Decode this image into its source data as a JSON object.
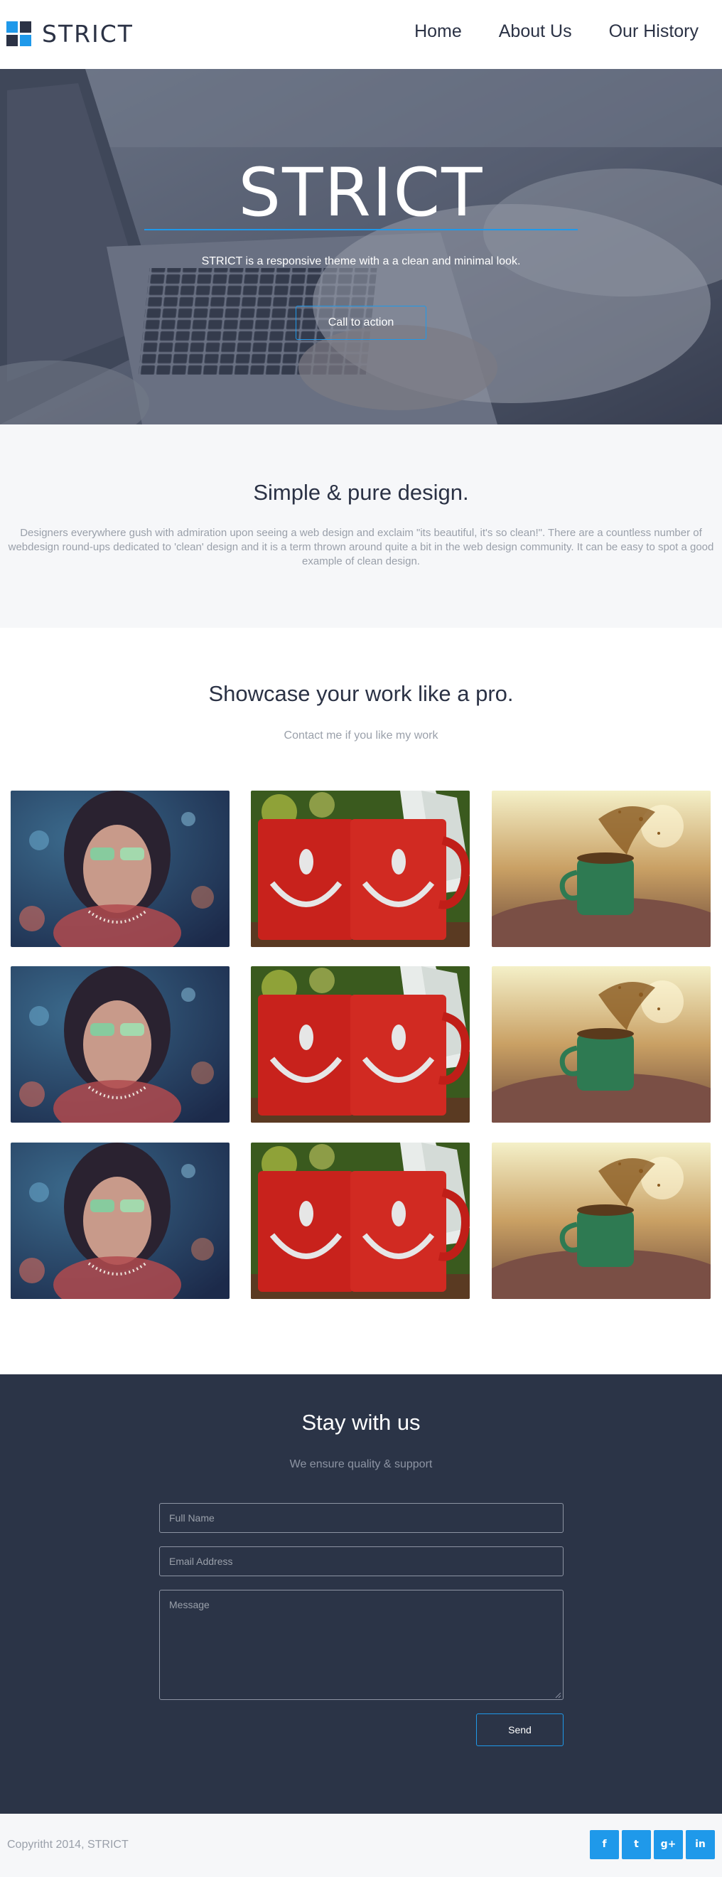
{
  "header": {
    "logo_text": "STRICT",
    "nav": [
      {
        "label": "Home"
      },
      {
        "label": "About Us"
      },
      {
        "label": "Our History"
      }
    ]
  },
  "hero": {
    "title": "STRICT",
    "subtitle": "STRICT is a responsive theme with a a clean and minimal look.",
    "cta_label": "Call to action"
  },
  "intro": {
    "heading": "Simple & pure design.",
    "body": "Designers everywhere gush with admiration upon seeing a web design and exclaim \"its beautiful, it's so clean!\". There are a countless number of webdesign round-ups dedicated to 'clean' design and it is a term thrown around quite a bit in the web design community. It can be easy to spot a good example of clean design."
  },
  "showcase": {
    "heading": "Showcase your work like a pro.",
    "subheading": "Contact me if you like my work",
    "gallery": [
      {
        "image": "woman-sunglasses-photo"
      },
      {
        "image": "red-smiley-mugs-photo"
      },
      {
        "image": "green-cup-splash-photo"
      },
      {
        "image": "woman-sunglasses-photo"
      },
      {
        "image": "red-smiley-mugs-photo"
      },
      {
        "image": "green-cup-splash-photo"
      },
      {
        "image": "woman-sunglasses-photo"
      },
      {
        "image": "red-smiley-mugs-photo"
      },
      {
        "image": "green-cup-splash-photo"
      }
    ]
  },
  "contact": {
    "heading": "Stay with us",
    "subheading": "We ensure quality & support",
    "name_placeholder": "Full Name",
    "email_placeholder": "Email Address",
    "message_placeholder": "Message",
    "send_label": "Send"
  },
  "footer": {
    "copyright": "Copyritht 2014, STRICT",
    "social": [
      {
        "icon": "facebook-icon",
        "glyph": "f"
      },
      {
        "icon": "twitter-icon",
        "glyph": "t"
      },
      {
        "icon": "google-plus-icon",
        "glyph": "g+"
      },
      {
        "icon": "linkedin-icon",
        "glyph": "in"
      }
    ]
  },
  "colors": {
    "accent": "#1f99ea",
    "navy": "#2b3245",
    "contact_bg": "#2b3447",
    "muted": "#9aa0aa",
    "light_bg": "#f6f7f9"
  }
}
